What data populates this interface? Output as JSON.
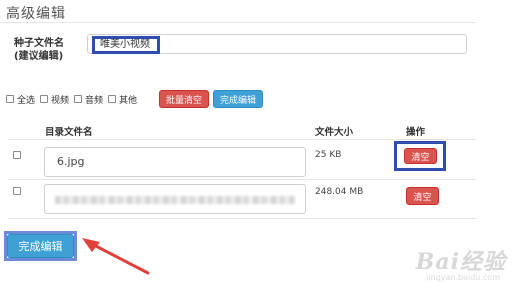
{
  "header": {
    "title": "高级编辑"
  },
  "seed": {
    "label_line1": "种子文件名",
    "label_line2": "(建议编辑)",
    "value": "唯美小视频"
  },
  "filters": {
    "select_all": "全选",
    "video": "视频",
    "audio": "音频",
    "other": "其他",
    "bulk_clear": "批量清空",
    "finish_edit": "完成编辑"
  },
  "table": {
    "headers": {
      "name": "目录文件名",
      "size": "文件大小",
      "action": "操作"
    },
    "rows": [
      {
        "name": "6.jpg",
        "size": "25 KB",
        "action": "清空"
      },
      {
        "name": "",
        "size": "248.04 MB",
        "action": "清空"
      }
    ]
  },
  "footer": {
    "finish_button": "完成编辑"
  },
  "watermark": {
    "text": "Bai经验",
    "sub": "jingyan.baidu.com"
  },
  "colors": {
    "danger": "#d9534f",
    "primary": "#3fa0d6",
    "highlight": "#2e4fb0",
    "arrow": "#e0413a"
  }
}
